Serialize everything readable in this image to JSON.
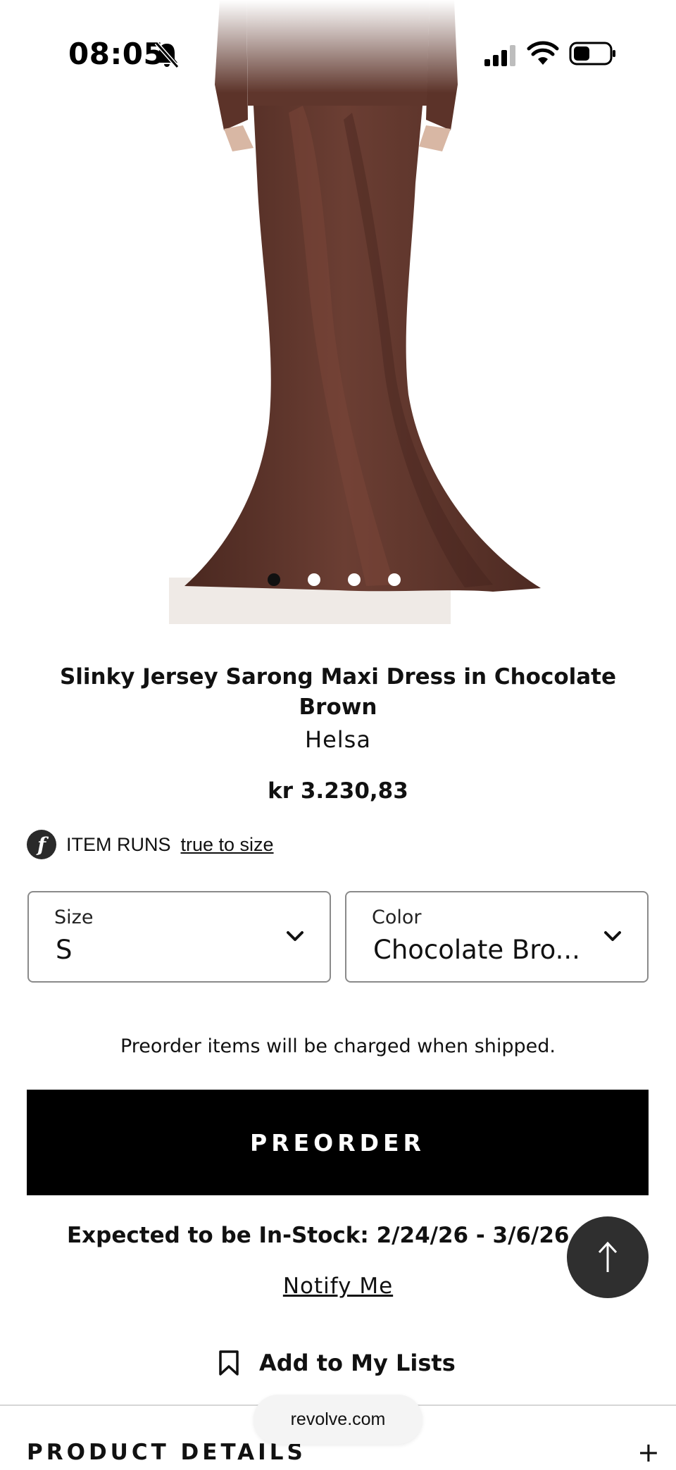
{
  "status_bar": {
    "time": "08:05",
    "icons": [
      "bell-slash-icon",
      "signal-icon",
      "wifi-icon",
      "battery-icon"
    ]
  },
  "carousel": {
    "image_count": 4,
    "active_index": 0
  },
  "product": {
    "title": "Slinky Jersey Sarong Maxi Dress in Chocolate Brown",
    "brand": "Helsa",
    "price": "kr 3.230,83"
  },
  "fit": {
    "icon": "f",
    "label": "ITEM RUNS",
    "link": "true to size"
  },
  "size_select": {
    "label": "Size",
    "value": "S"
  },
  "color_select": {
    "label": "Color",
    "value": "Chocolate Bro..."
  },
  "preorder": {
    "note": "Preorder items will be charged when shipped.",
    "button_label": "PREORDER"
  },
  "stock": {
    "expected": "Expected to be In-Stock: 2/24/26 - 3/6/26",
    "help": "?"
  },
  "notify_label": "Notify Me",
  "lists_label": "Add to My Lists",
  "details_label": "PRODUCT DETAILS",
  "details_toggle": "+",
  "url": "revolve.com",
  "colors": {
    "dress": "#5a3329",
    "button_bg": "#000000",
    "scroll_top_bg": "#2f2f2f"
  }
}
